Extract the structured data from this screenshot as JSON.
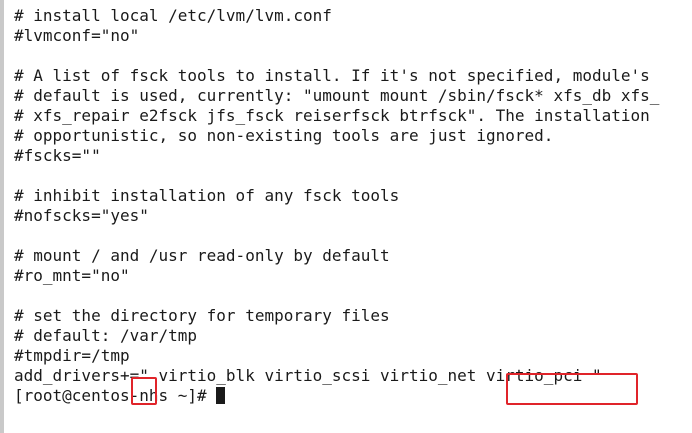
{
  "terminal": {
    "lines": [
      "# install local /etc/lvm/lvm.conf",
      "#lvmconf=\"no\"",
      "",
      "# A list of fsck tools to install. If it's not specified, module's",
      "# default is used, currently: \"umount mount /sbin/fsck* xfs_db xfs_",
      "# xfs_repair e2fsck jfs_fsck reiserfsck btrfsck\". The installation",
      "# opportunistic, so non-existing tools are just ignored.",
      "#fscks=\"\"",
      "",
      "# inhibit installation of any fsck tools",
      "#nofscks=\"yes\"",
      "",
      "# mount / and /usr read-only by default",
      "#ro_mnt=\"no\"",
      "",
      "# set the directory for temporary files",
      "# default: /var/tmp",
      "#tmpdir=/tmp",
      "add_drivers+=\" virtio_blk virtio_scsi virtio_net virtio_pci \"",
      "[root@centos-nhs ~]#"
    ]
  },
  "colors": {
    "text": "#1a1a1a",
    "background": "#ffffff",
    "highlight": "#e0242a"
  }
}
